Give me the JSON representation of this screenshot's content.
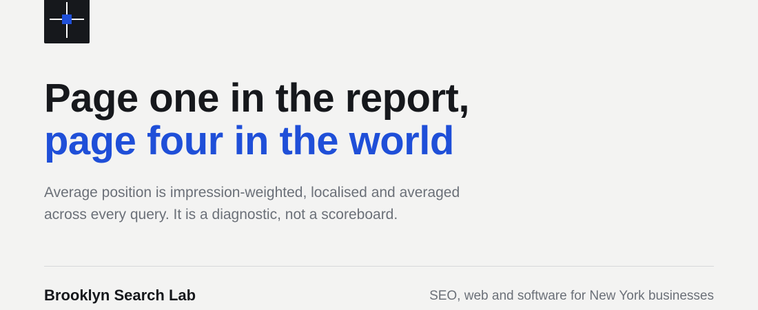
{
  "logo": {
    "icon": "crosshair-square-icon",
    "background_color": "#16181c",
    "accent_color": "#1f4fd8"
  },
  "headline": {
    "line1": "Page one in the report,",
    "line2": "page four in the world",
    "line1_color": "#16181c",
    "line2_color": "#1f4fd8"
  },
  "subtitle": {
    "line1": "Average position is impression-weighted, localised and averaged",
    "line2": "across every query. It is a diagnostic, not a scoreboard."
  },
  "footer": {
    "brand": "Brooklyn Search Lab",
    "tagline": "SEO, web and software for New York businesses"
  }
}
